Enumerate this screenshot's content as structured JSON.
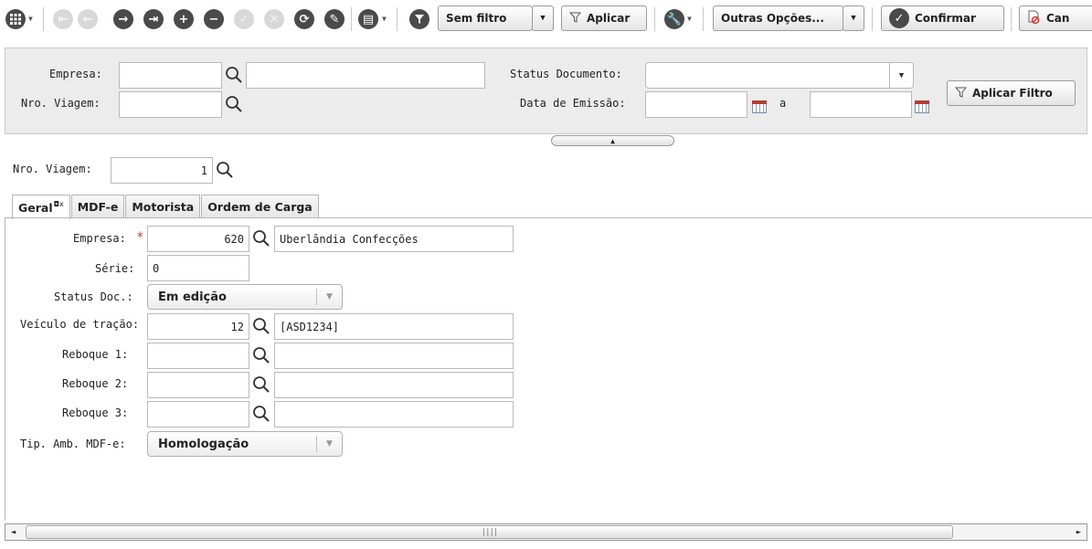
{
  "toolbar": {
    "filter_select": "Sem filtro",
    "apply_label": "Aplicar",
    "more_options": "Outras Opções...",
    "confirm_label": "Confirmar",
    "cancel_label": "Can"
  },
  "filter": {
    "empresa_label": "Empresa:",
    "nro_viagem_label": "Nro. Viagem:",
    "status_label": "Status Documento:",
    "data_emissao_label": "Data de Emissão:",
    "date_separator": "a",
    "apply_filter_label": "Aplicar Filtro"
  },
  "record": {
    "nro_viagem_label": "Nro. Viagem:",
    "nro_viagem_value": "1"
  },
  "tabs": [
    {
      "label": "Geral"
    },
    {
      "label": "MDF-e"
    },
    {
      "label": "Motorista"
    },
    {
      "label": "Ordem de Carga"
    }
  ],
  "form": {
    "empresa_label": "Empresa:",
    "empresa_code": "620",
    "empresa_name": "Uberlândia Confecções",
    "serie_label": "Série:",
    "serie_value": "0",
    "status_label": "Status Doc.:",
    "status_value": "Em edição",
    "veiculo_label": "Veículo de tração:",
    "veiculo_code": "12",
    "veiculo_name": "[ASD1234]",
    "reboque1_label": "Reboque 1:",
    "reboque2_label": "Reboque 2:",
    "reboque3_label": "Reboque 3:",
    "tip_amb_label": "Tip. Amb. MDF-e:",
    "tip_amb_value": "Homologação"
  },
  "icons": {
    "grid": "grid-menu-icon",
    "search": "magnifier-icon",
    "calendar": "calendar-icon",
    "filter": "funnel-icon",
    "wrench": "wrench-icon",
    "confirm": "check-circle-icon",
    "cancel": "cancel-document-icon"
  },
  "colors": {
    "required": "#d9322a",
    "panel_bg": "#ececec",
    "icon_dark": "#4a4a4a"
  }
}
